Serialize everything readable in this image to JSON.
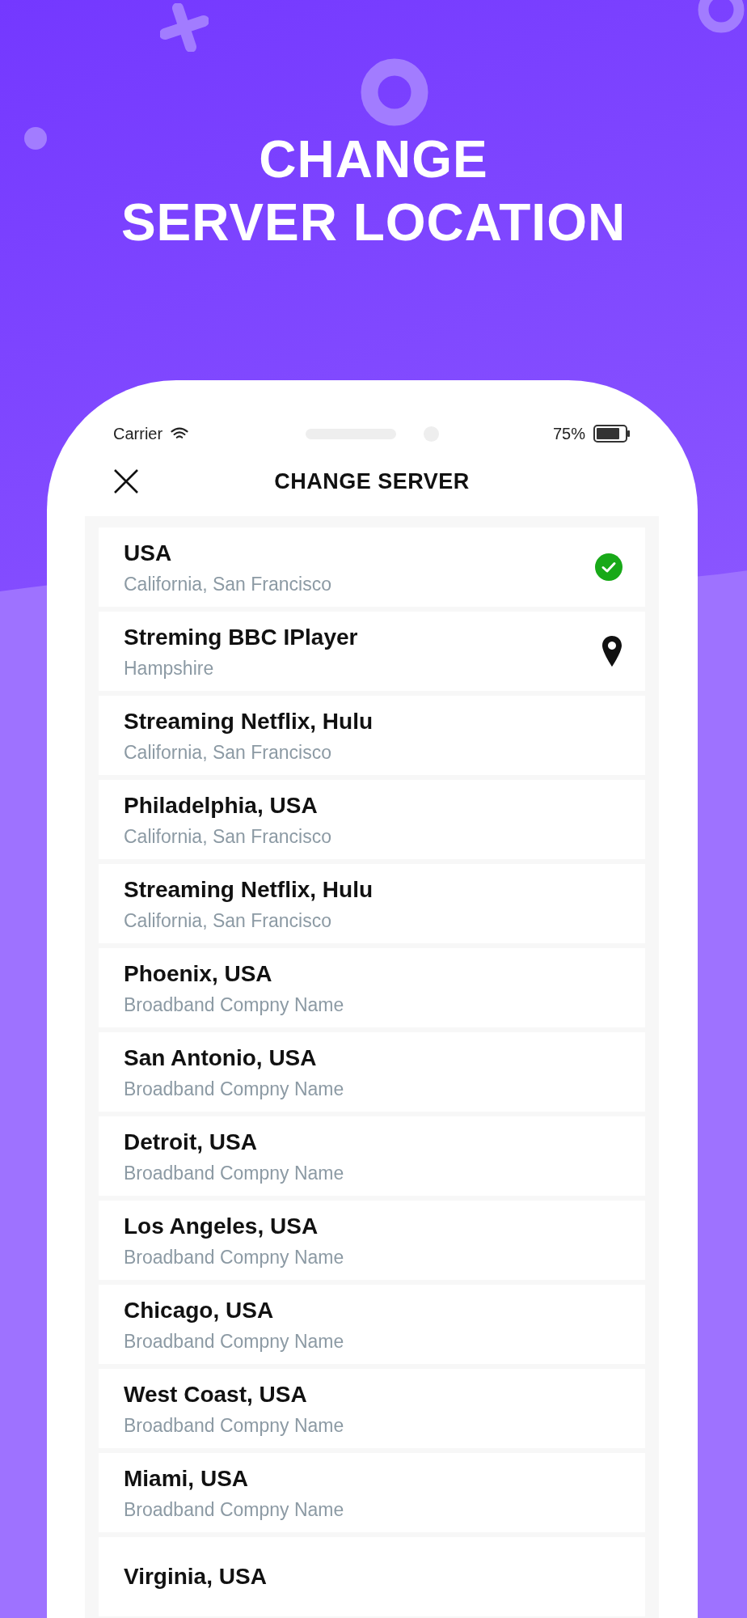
{
  "promo": {
    "headline": [
      "CHANGE",
      "SERVER LOCATION"
    ]
  },
  "status_bar": {
    "carrier": "Carrier",
    "battery": "75%"
  },
  "header": {
    "title": "CHANGE SERVER"
  },
  "servers": [
    {
      "name": "USA",
      "detail": "California, San Francisco",
      "selected": true,
      "pinned": false
    },
    {
      "name": "Streming BBC IPlayer",
      "detail": "Hampshire",
      "selected": false,
      "pinned": true
    },
    {
      "name": "Streaming Netflix, Hulu",
      "detail": "California, San Francisco",
      "selected": false,
      "pinned": false
    },
    {
      "name": "Philadelphia, USA",
      "detail": "California, San Francisco",
      "selected": false,
      "pinned": false
    },
    {
      "name": "Streaming Netflix, Hulu",
      "detail": "California, San Francisco",
      "selected": false,
      "pinned": false
    },
    {
      "name": "Phoenix, USA",
      "detail": "Broadband Compny Name",
      "selected": false,
      "pinned": false
    },
    {
      "name": "San Antonio, USA",
      "detail": "Broadband Compny Name",
      "selected": false,
      "pinned": false
    },
    {
      "name": "Detroit, USA",
      "detail": "Broadband Compny Name",
      "selected": false,
      "pinned": false
    },
    {
      "name": "Los Angeles, USA",
      "detail": "Broadband Compny Name",
      "selected": false,
      "pinned": false
    },
    {
      "name": "Chicago, USA",
      "detail": "Broadband Compny Name",
      "selected": false,
      "pinned": false
    },
    {
      "name": "West Coast, USA",
      "detail": "Broadband Compny Name",
      "selected": false,
      "pinned": false
    },
    {
      "name": "Miami, USA",
      "detail": "Broadband Compny Name",
      "selected": false,
      "pinned": false
    },
    {
      "name": "Virginia, USA",
      "selected": false,
      "pinned": false
    }
  ]
}
